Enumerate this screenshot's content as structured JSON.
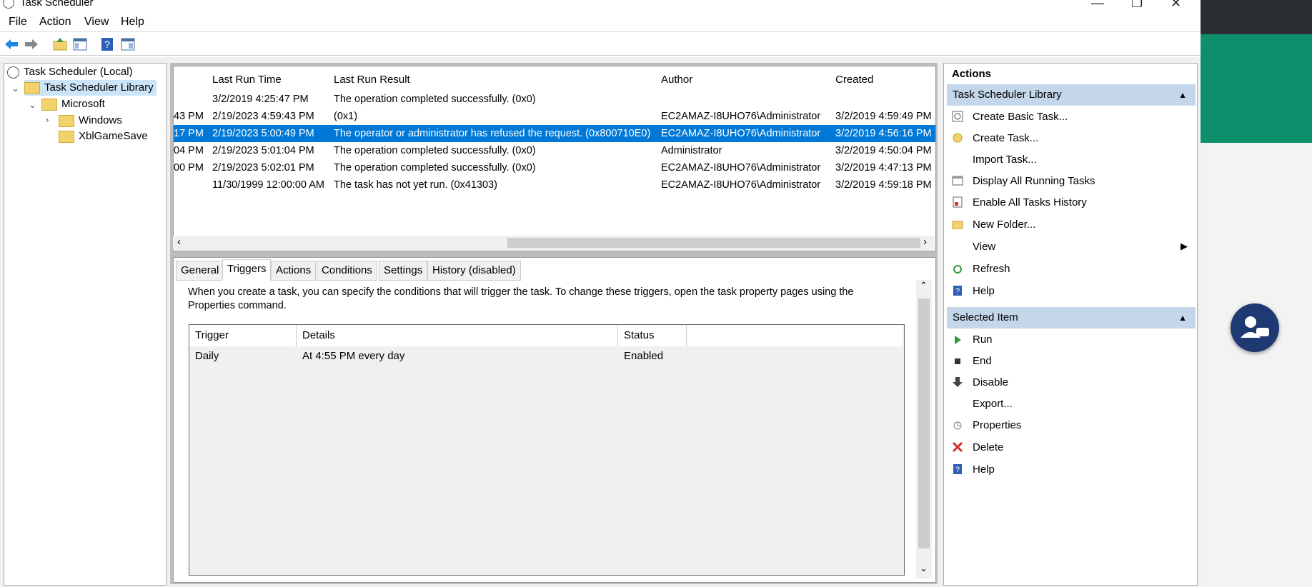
{
  "window": {
    "title": "Task Scheduler"
  },
  "menu": [
    "File",
    "Action",
    "View",
    "Help"
  ],
  "tree": {
    "root": "Task Scheduler (Local)",
    "library": "Task Scheduler Library",
    "microsoft": "Microsoft",
    "windows": "Windows",
    "xbl": "XblGameSave"
  },
  "list": {
    "columns": [
      "Last Run Time",
      "Last Run Result",
      "Author",
      "Created"
    ],
    "rows": [
      {
        "prev": "",
        "last_run": "3/2/2019 4:25:47 PM",
        "result": "The operation completed successfully. (0x0)",
        "author": "",
        "created": ""
      },
      {
        "prev": "43 PM",
        "last_run": "2/19/2023 4:59:43 PM",
        "result": "(0x1)",
        "author": "EC2AMAZ-I8UHO76\\Administrator",
        "created": "3/2/2019 4:59:49 PM"
      },
      {
        "prev": "17 PM",
        "last_run": "2/19/2023 5:00:49 PM",
        "result": "The operator or administrator has refused the request. (0x800710E0)",
        "author": "EC2AMAZ-I8UHO76\\Administrator",
        "created": "3/2/2019 4:56:16 PM"
      },
      {
        "prev": "04 PM",
        "last_run": "2/19/2023 5:01:04 PM",
        "result": "The operation completed successfully. (0x0)",
        "author": "Administrator",
        "created": "3/2/2019 4:50:04 PM"
      },
      {
        "prev": "00 PM",
        "last_run": "2/19/2023 5:02:01 PM",
        "result": "The operation completed successfully. (0x0)",
        "author": "EC2AMAZ-I8UHO76\\Administrator",
        "created": "3/2/2019 4:47:13 PM"
      },
      {
        "prev": "",
        "last_run": "11/30/1999 12:00:00 AM",
        "result": "The task has not yet run. (0x41303)",
        "author": "EC2AMAZ-I8UHO76\\Administrator",
        "created": "3/2/2019 4:59:18 PM"
      }
    ],
    "selected_row": 2
  },
  "tabs": [
    "General",
    "Triggers",
    "Actions",
    "Conditions",
    "Settings",
    "History (disabled)"
  ],
  "active_tab": "Triggers",
  "triggers": {
    "description": "When you create a task, you can specify the conditions that will trigger the task.  To change these triggers, open the task property pages using the Properties command.",
    "columns": [
      "Trigger",
      "Details",
      "Status"
    ],
    "rows": [
      {
        "trigger": "Daily",
        "details": "At 4:55 PM every day",
        "status": "Enabled"
      }
    ]
  },
  "actions": {
    "header": "Actions",
    "section1": "Task Scheduler Library",
    "section1_items": [
      "Create Basic Task...",
      "Create Task...",
      "Import Task...",
      "Display All Running Tasks",
      "Enable All Tasks History",
      "New Folder...",
      "View",
      "Refresh",
      "Help"
    ],
    "section2": "Selected Item",
    "section2_items": [
      "Run",
      "End",
      "Disable",
      "Export...",
      "Properties",
      "Delete",
      "Help"
    ]
  },
  "colors": {
    "selection": "#0078d7",
    "section_header": "#c4d6ea",
    "teal": "#0e8f6c"
  }
}
